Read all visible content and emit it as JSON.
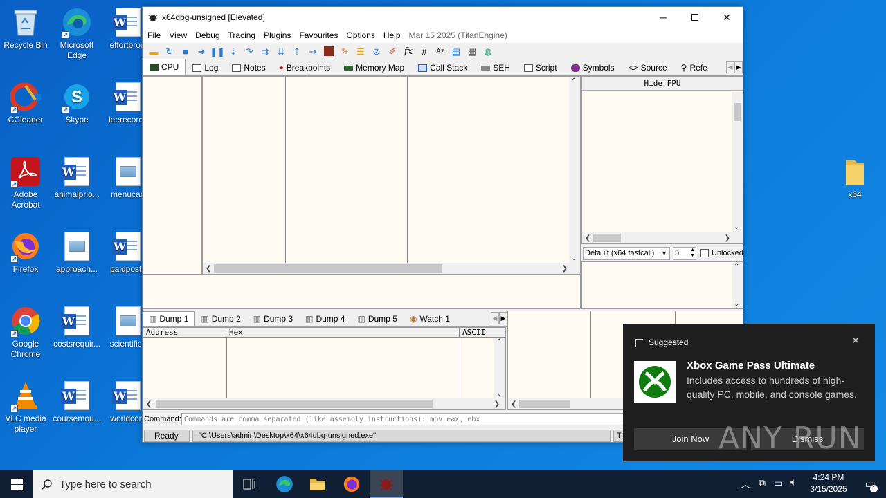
{
  "desktop": {
    "icons": [
      {
        "label": "Recycle Bin",
        "icon": "recycle-bin-icon"
      },
      {
        "label": "Microsoft Edge",
        "icon": "edge-icon"
      },
      {
        "label": "effortbrow",
        "icon": "word-doc-icon"
      },
      {
        "label": "CCleaner",
        "icon": "ccleaner-icon"
      },
      {
        "label": "Skype",
        "icon": "skype-icon"
      },
      {
        "label": "leerecords",
        "icon": "word-doc-icon"
      },
      {
        "label": "Adobe Acrobat",
        "icon": "acrobat-icon"
      },
      {
        "label": "animalprio...",
        "icon": "word-doc-icon"
      },
      {
        "label": "menucart",
        "icon": "image-file-icon"
      },
      {
        "label": "Firefox",
        "icon": "firefox-icon"
      },
      {
        "label": "approach...",
        "icon": "image-file-icon"
      },
      {
        "label": "paidposte",
        "icon": "word-doc-icon"
      },
      {
        "label": "Google Chrome",
        "icon": "chrome-icon"
      },
      {
        "label": "costsrequir...",
        "icon": "word-doc-icon"
      },
      {
        "label": "scientifica",
        "icon": "image-file-icon"
      },
      {
        "label": "VLC media player",
        "icon": "vlc-icon"
      },
      {
        "label": "coursemou...",
        "icon": "word-doc-icon"
      },
      {
        "label": "worldcom",
        "icon": "word-doc-icon"
      },
      {
        "label": "x64",
        "icon": "folder-icon"
      }
    ]
  },
  "window": {
    "title": "x64dbg-unsigned [Elevated]",
    "menu": [
      "File",
      "View",
      "Debug",
      "Tracing",
      "Plugins",
      "Favourites",
      "Options",
      "Help"
    ],
    "menu_date": "Mar 15 2025 (TitanEngine)",
    "tabs": [
      "CPU",
      "Log",
      "Notes",
      "Breakpoints",
      "Memory Map",
      "Call Stack",
      "SEH",
      "Script",
      "Symbols",
      "Source",
      "Refe"
    ],
    "hide_fpu": "Hide FPU",
    "callconv": "Default (x64 fastcall)",
    "argcount": "5",
    "unlocked": "Unlocked",
    "dump_tabs": [
      "Dump 1",
      "Dump 2",
      "Dump 3",
      "Dump 4",
      "Dump 5",
      "Watch 1"
    ],
    "dump_cols": [
      "Address",
      "Hex",
      "ASCII"
    ],
    "command_label": "Command:",
    "command_placeholder": "Commands are comma separated (like assembly instructions): mov eax, ebx",
    "status": "Ready",
    "status_path": "\"C:\\Users\\admin\\Desktop\\x64\\x64dbg-unsigned.exe\"",
    "status_right": "Ti"
  },
  "toast": {
    "header": "Suggested",
    "title": "Xbox Game Pass Ultimate",
    "body": "Includes access to hundreds of high-quality PC, mobile, and console games.",
    "primary": "Join Now",
    "secondary": "Dismiss"
  },
  "watermark": "ANY RUN",
  "taskbar": {
    "search_placeholder": "Type here to search",
    "time": "4:24 PM",
    "date": "3/15/2025",
    "notif_count": "1"
  },
  "colors": {
    "desktop": "#0b78d8",
    "taskbar": "#101f33",
    "pane_bg": "#fffaf2",
    "toast_bg": "#1f1f1f"
  }
}
